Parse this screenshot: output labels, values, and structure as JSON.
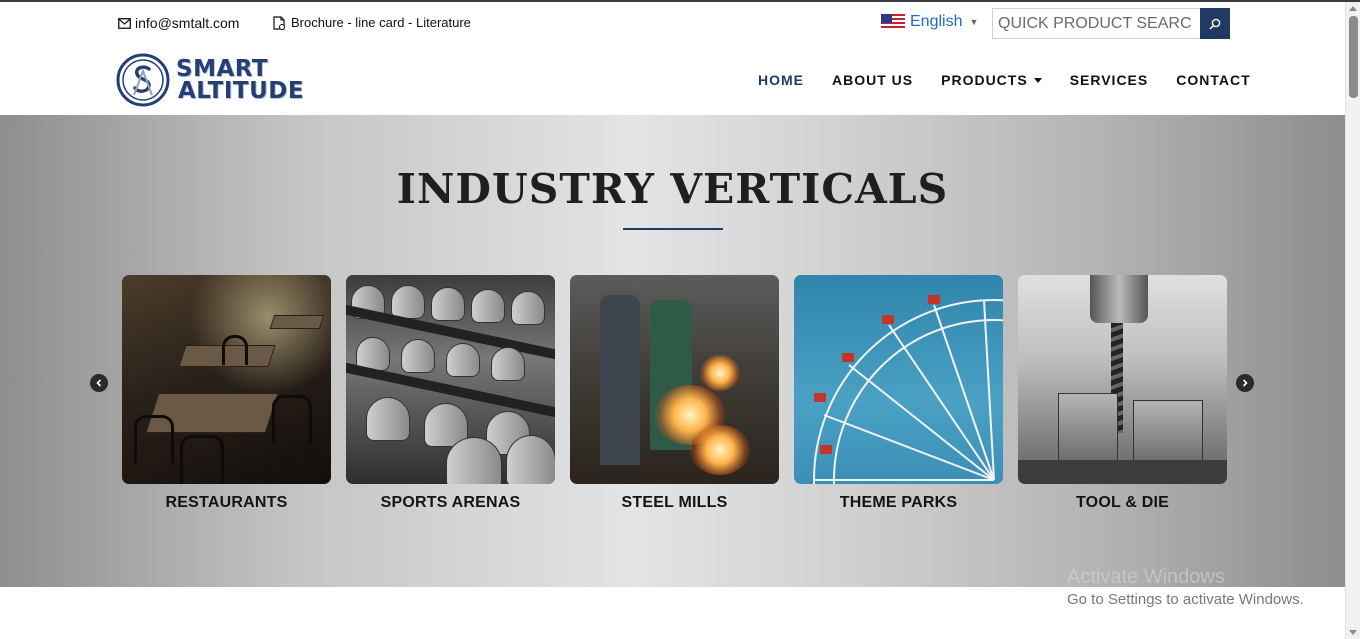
{
  "topbar": {
    "email": "info@smtalt.com",
    "docs_text": "Brochure - line card - Literature",
    "language": "English",
    "search_placeholder": "QUICK PRODUCT SEARC"
  },
  "logo": {
    "line1": "SMART",
    "line2": "ALTITUDE"
  },
  "nav": {
    "items": [
      {
        "label": "HOME",
        "active": true
      },
      {
        "label": "ABOUT US",
        "active": false
      },
      {
        "label": "PRODUCTS",
        "active": false,
        "dropdown": true
      },
      {
        "label": "SERVICES",
        "active": false
      },
      {
        "label": "CONTACT",
        "active": false
      }
    ]
  },
  "hero": {
    "title": "INDUSTRY VERTICALS",
    "cards": [
      {
        "label": "RESTAURANTS"
      },
      {
        "label": "SPORTS ARENAS"
      },
      {
        "label": "STEEL MILLS"
      },
      {
        "label": "THEME PARKS"
      },
      {
        "label": "TOOL & DIE"
      }
    ]
  },
  "watermark": {
    "line1": "Activate Windows",
    "line2": "Go to Settings to activate Windows."
  },
  "colors": {
    "brand": "#1f3a63",
    "link": "#1a6cc4"
  },
  "icons": {
    "email": "envelope-icon",
    "docs": "document-icon",
    "search": "search-icon",
    "prev": "chevron-left-icon",
    "next": "chevron-right-icon"
  }
}
